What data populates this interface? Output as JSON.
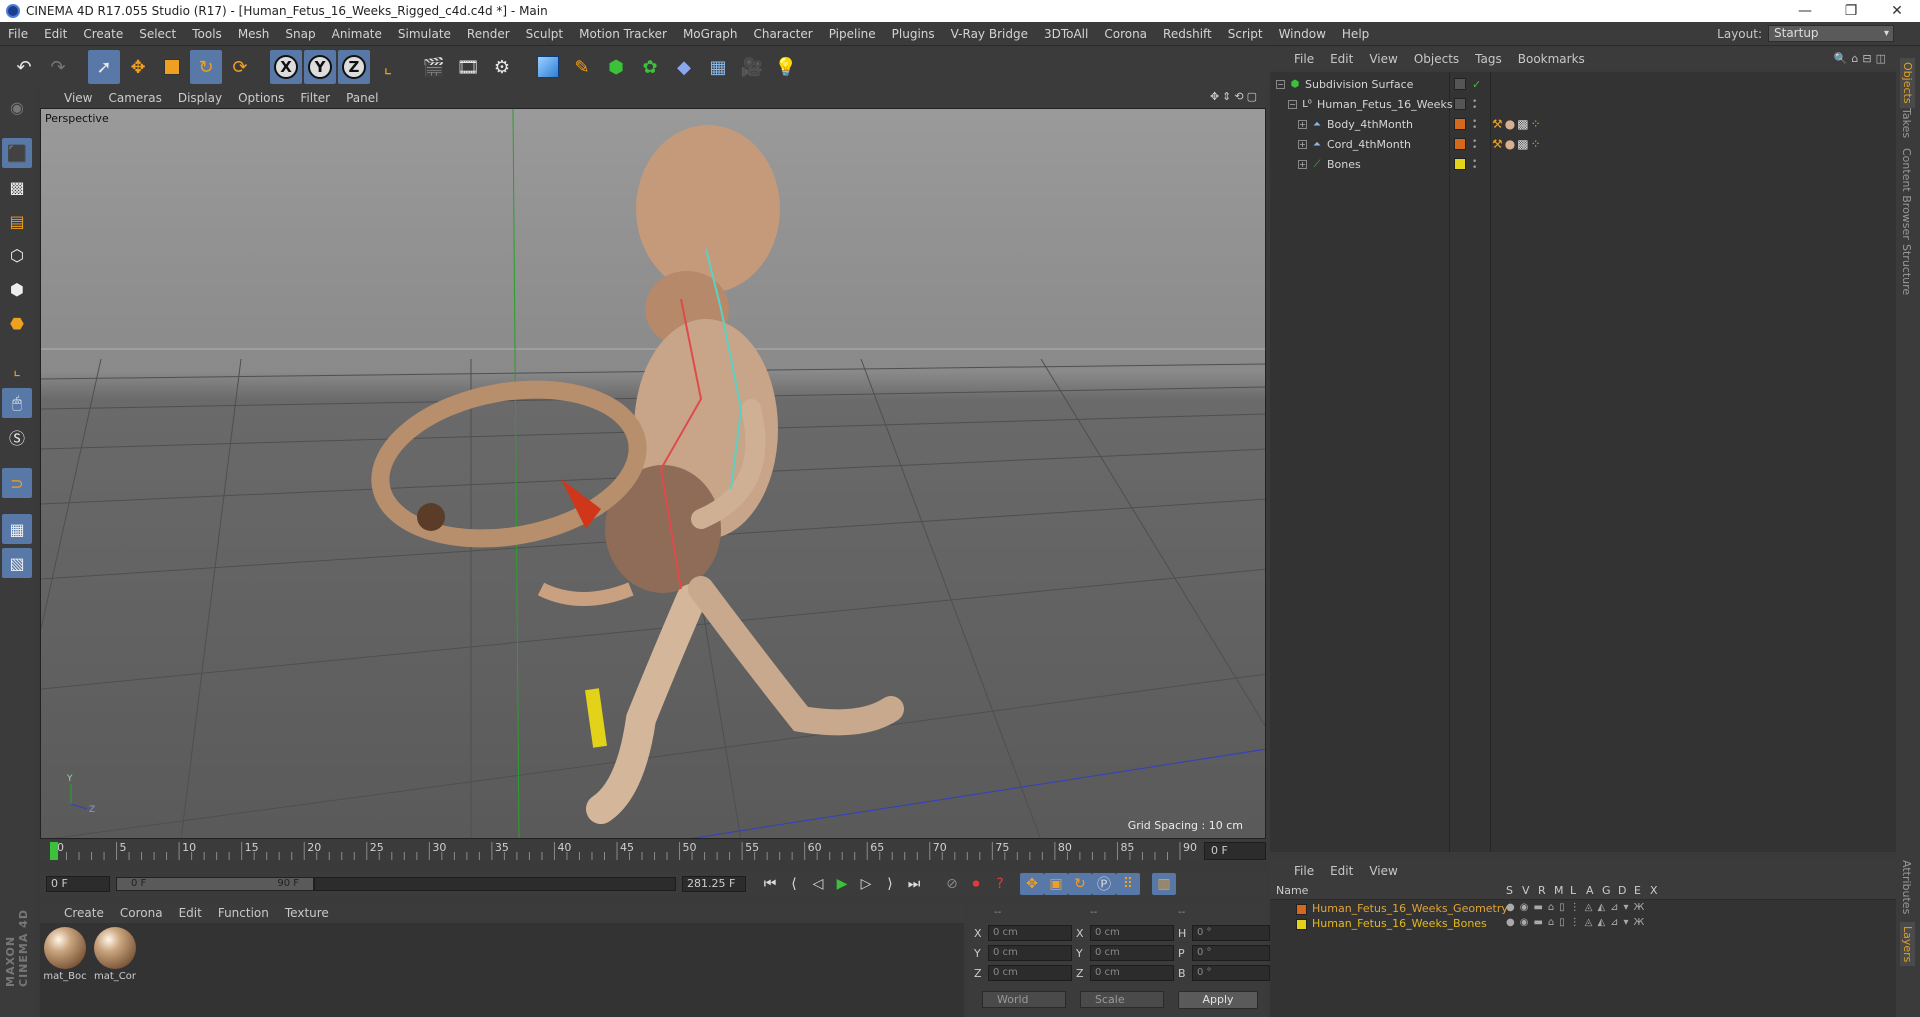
{
  "window": {
    "title": "CINEMA 4D R17.055 Studio (R17) - [Human_Fetus_16_Weeks_Rigged_c4d.c4d *] - Main",
    "minimize": "—",
    "maximize": "❐",
    "close": "✕"
  },
  "menu": [
    "File",
    "Edit",
    "Create",
    "Select",
    "Tools",
    "Mesh",
    "Snap",
    "Animate",
    "Simulate",
    "Render",
    "Sculpt",
    "Motion Tracker",
    "MoGraph",
    "Character",
    "Pipeline",
    "Plugins",
    "V-Ray Bridge",
    "3DToAll",
    "Corona",
    "Redshift",
    "Script",
    "Window",
    "Help"
  ],
  "layout": {
    "label": "Layout:",
    "value": "Startup"
  },
  "toolbar": {
    "x": "X",
    "y": "Y",
    "z": "Z"
  },
  "viewport": {
    "menu": [
      "View",
      "Cameras",
      "Display",
      "Options",
      "Filter",
      "Panel"
    ],
    "label": "Perspective",
    "grid_spacing": "Grid Spacing : 10 cm",
    "axis_y": "Y",
    "axis_z": "Z"
  },
  "timeline": {
    "ticks": [
      "0",
      "5",
      "10",
      "15",
      "20",
      "25",
      "30",
      "35",
      "40",
      "45",
      "50",
      "55",
      "60",
      "65",
      "70",
      "75",
      "80",
      "85",
      "90"
    ],
    "current_frame": "0 F",
    "start_field": "0 F",
    "range_start": "0 F",
    "range_end": "90 F",
    "end_field": "281.25 F"
  },
  "materials": {
    "menu": [
      "Create",
      "Corona",
      "Edit",
      "Function",
      "Texture"
    ],
    "items": [
      {
        "name": "mat_Boc"
      },
      {
        "name": "mat_Cor"
      }
    ]
  },
  "coordinates": {
    "headers": [
      "--",
      "--",
      "--"
    ],
    "rows": [
      {
        "a": "X",
        "av": "0 cm",
        "b": "X",
        "bv": "0 cm",
        "c": "H",
        "cv": "0 °"
      },
      {
        "a": "Y",
        "av": "0 cm",
        "b": "Y",
        "bv": "0 cm",
        "c": "P",
        "cv": "0 °"
      },
      {
        "a": "Z",
        "av": "0 cm",
        "b": "Z",
        "bv": "0 cm",
        "c": "B",
        "cv": "0 °"
      }
    ],
    "space": "World",
    "mode": "Scale",
    "apply": "Apply"
  },
  "objects": {
    "menu": [
      "File",
      "Edit",
      "View",
      "Objects",
      "Tags",
      "Bookmarks"
    ],
    "items": [
      {
        "name": "Subdivision Surface",
        "color": "#3a3a3a"
      },
      {
        "name": "Human_Fetus_16_Weeks",
        "color": "#3a3a3a"
      },
      {
        "name": "Body_4thMonth",
        "color": "#d4691e"
      },
      {
        "name": "Cord_4thMonth",
        "color": "#d4691e"
      },
      {
        "name": "Bones",
        "color": "#e3d21a"
      }
    ]
  },
  "layers": {
    "menu": [
      "File",
      "Edit",
      "View"
    ],
    "columns": [
      "Name",
      "S",
      "V",
      "R",
      "M",
      "L",
      "A",
      "G",
      "D",
      "E",
      "X"
    ],
    "items": [
      {
        "name": "Human_Fetus_16_Weeks_Geometry",
        "color": "#d4691e",
        "text_color": "#e0a53a"
      },
      {
        "name": "Human_Fetus_16_Weeks_Bones",
        "color": "#e3d21a",
        "text_color": "#e6b81c"
      }
    ]
  },
  "side_tabs": [
    "Objects",
    "Takes",
    "Content Browser",
    "Structure"
  ],
  "side_tabs_lower": [
    "Attributes",
    "Layers"
  ],
  "brand": "MAXON CINEMA 4D"
}
